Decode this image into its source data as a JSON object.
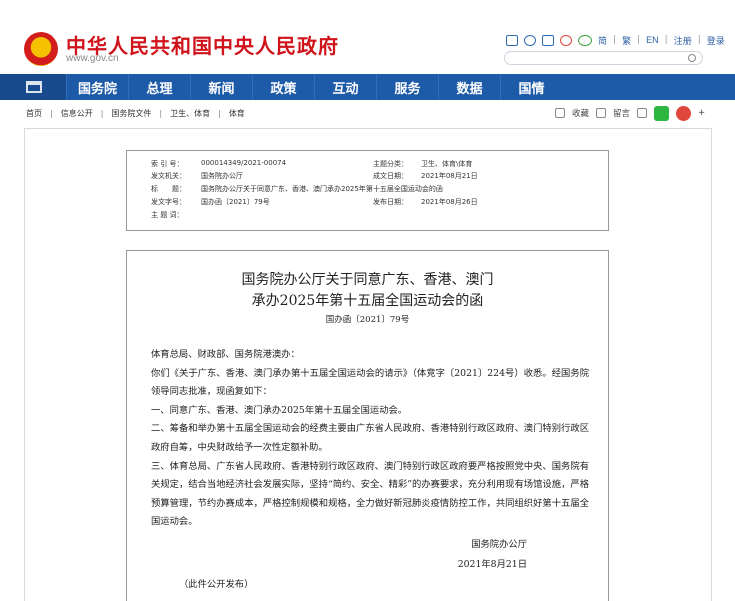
{
  "header": {
    "site_title": "中华人民共和国中央人民政府",
    "site_domain": "www.gov.cn",
    "lang_links": [
      "简",
      "繁",
      "EN"
    ],
    "account_links": [
      "注册",
      "登录"
    ]
  },
  "nav": {
    "items": [
      "国务院",
      "总理",
      "新闻",
      "政策",
      "互动",
      "服务",
      "数据",
      "国情"
    ]
  },
  "breadcrumb": [
    "首页",
    "信息公开",
    "国务院文件",
    "卫生、体育",
    "体育"
  ],
  "share": {
    "favorite_label": "收藏",
    "comment_label": "留言",
    "more_label": "+"
  },
  "meta": {
    "index_no_label": "索 引 号：",
    "index_no": "000014349/2021-00074",
    "category_label": "主题分类：",
    "category": "卫生、体育\\体育",
    "issuer_label": "发文机关：",
    "issuer": "国务院办公厅",
    "written_date_label": "成文日期：",
    "written_date": "2021年08月21日",
    "title_label": "标　　题：",
    "title": "国务院办公厅关于同意广东、香港、澳门承办2025年第十五届全国运动会的函",
    "doc_no_label": "发文字号：",
    "doc_no": "国办函〔2021〕79号",
    "publish_date_label": "发布日期：",
    "publish_date": "2021年08月26日",
    "keywords_label": "主 题 词：",
    "keywords": ""
  },
  "document": {
    "title_line1": "国务院办公厅关于同意广东、香港、澳门",
    "title_line2": "承办2025年第十五届全国运动会的函",
    "number": "国办函〔2021〕79号",
    "addressee": "体育总局、财政部、国务院港澳办：",
    "paragraphs": [
      "你们《关于广东、香港、澳门承办第十五届全国运动会的请示》（体竞字〔2021〕224号）收悉。经国务院领导同志批准，现函复如下：",
      "一、同意广东、香港、澳门承办2025年第十五届全国运动会。",
      "二、筹备和举办第十五届全国运动会的经费主要由广东省人民政府、香港特别行政区政府、澳门特别行政区政府自筹，中央财政给予一次性定额补助。",
      "三、体育总局、广东省人民政府、香港特别行政区政府、澳门特别行政区政府要严格按照党中央、国务院有关规定，结合当地经济社会发展实际，坚持“简约、安全、精彩”的办赛要求，充分利用现有场馆设施，严格预算管理，节约办赛成本，严格控制规模和规格，全力做好新冠肺炎疫情防控工作，共同组织好第十五届全国运动会。"
    ],
    "signer": "国务院办公厅",
    "date": "2021年8月21日",
    "note": "（此件公开发布）"
  },
  "colors": {
    "brand_red": "#d0121a",
    "nav_blue": "#1d5aa8"
  }
}
